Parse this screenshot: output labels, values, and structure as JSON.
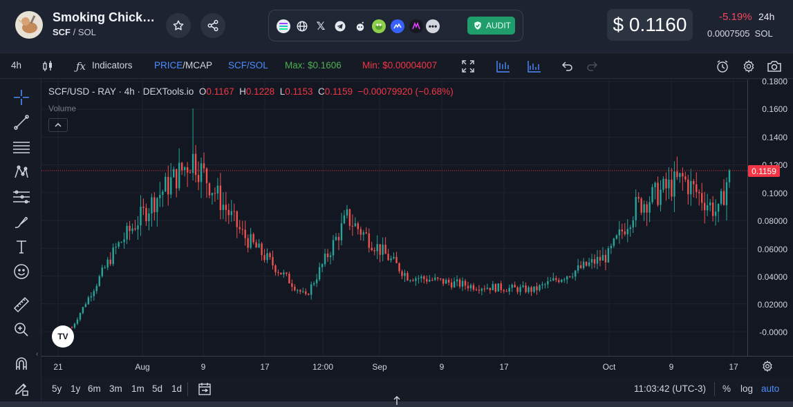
{
  "header": {
    "token_name": "Smoking Chicke…",
    "token_symbol": "SCF",
    "pair_separator": " / ",
    "quote": "SOL",
    "price_usd": "$ 0.1160",
    "change_pct": "-5.19%",
    "change_period": "24h",
    "price_sol": "0.0007505  SOL",
    "audit_label": "AUDIT",
    "link_icons": [
      "solana-icon",
      "website-icon",
      "x-icon",
      "telegram-icon",
      "reddit-icon",
      "pepe-icon",
      "coinmarketcap-icon",
      "dextools-icon",
      "more-icon"
    ]
  },
  "toolbar": {
    "interval": "4h",
    "indicators": "Indicators",
    "price_label": "PRICE",
    "mcap_label": "/MCAP",
    "pair": "SCF/SOL",
    "max": "Max: $0.1606",
    "min": "Min: $0.00004007"
  },
  "chart": {
    "legend_title": "SCF/USD - RAY · 4h · DEXTools.io",
    "o": "0.1167",
    "h": "0.1228",
    "l": "0.1153",
    "c": "0.1159",
    "change": "−0.00079920 (−0.68%)",
    "volume_label": "Volume",
    "last_price": "0.1159",
    "logo_text": "TV",
    "y_labels": [
      "0.1800",
      "0.1600",
      "0.1400",
      "0.1200",
      "0.1000",
      "0.08000",
      "0.06000",
      "0.04000",
      "0.02000",
      "-0.0000"
    ],
    "x_labels": [
      "21",
      "Aug",
      "9",
      "17",
      "12:00",
      "Sep",
      "9",
      "17",
      "Oct",
      "9",
      "17"
    ]
  },
  "chart_data": {
    "type": "candlestick",
    "title": "SCF/USD - RAY · 4h · DEXTools.io",
    "ylim": [
      -0.005,
      0.18
    ],
    "key_points": [
      {
        "x": "Jul 21",
        "close": 0.003
      },
      {
        "x": "Jul 25",
        "close": 0.06
      },
      {
        "x": "Jul 30",
        "close": 0.095
      },
      {
        "x": "Aug 4",
        "close": 0.125,
        "high": 0.1606
      },
      {
        "x": "Aug 9",
        "close": 0.07
      },
      {
        "x": "Aug 17",
        "close": 0.025
      },
      {
        "x": "Aug 22",
        "close": 0.082
      },
      {
        "x": "Sep 1",
        "close": 0.04
      },
      {
        "x": "Sep 9",
        "close": 0.033
      },
      {
        "x": "Sep 17",
        "close": 0.03
      },
      {
        "x": "Sep 28",
        "close": 0.055
      },
      {
        "x": "Oct 1",
        "close": 0.09
      },
      {
        "x": "Oct 7",
        "close": 0.11
      },
      {
        "x": "Oct 12",
        "close": 0.085
      },
      {
        "x": "Oct 15",
        "close": 0.13
      },
      {
        "x": "Oct 17",
        "close": 0.1159
      }
    ]
  },
  "bottom": {
    "ranges": [
      "5y",
      "1y",
      "6m",
      "3m",
      "1m",
      "5d",
      "1d"
    ],
    "time": "11:03:42 (UTC-3)",
    "percent": "%",
    "log": "log",
    "auto": "auto"
  },
  "colors": {
    "up": "#26a69a",
    "down": "#ef5350",
    "accent": "#2962ff",
    "max": "#4caf50",
    "min": "#f23645"
  }
}
